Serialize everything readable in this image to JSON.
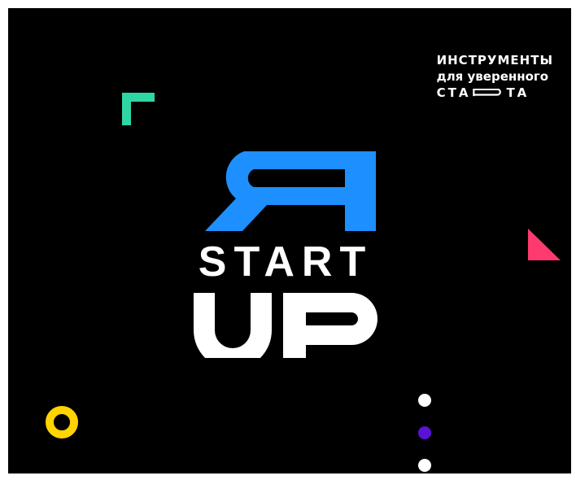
{
  "tagline": {
    "line1": "ИНСТРУМЕНТЫ",
    "line2": "для уверенного",
    "line3_start": "СТА",
    "line3_end": "ТА"
  },
  "logo": {
    "symbol": "Я",
    "word1": "START",
    "word2": "UP"
  },
  "colors": {
    "background": "#000000",
    "logo_blue": "#1e8fff",
    "green": "#2fd6a5",
    "pink": "#ff3a6e",
    "yellow": "#ffd400",
    "purple": "#5a12d6",
    "white": "#ffffff"
  }
}
